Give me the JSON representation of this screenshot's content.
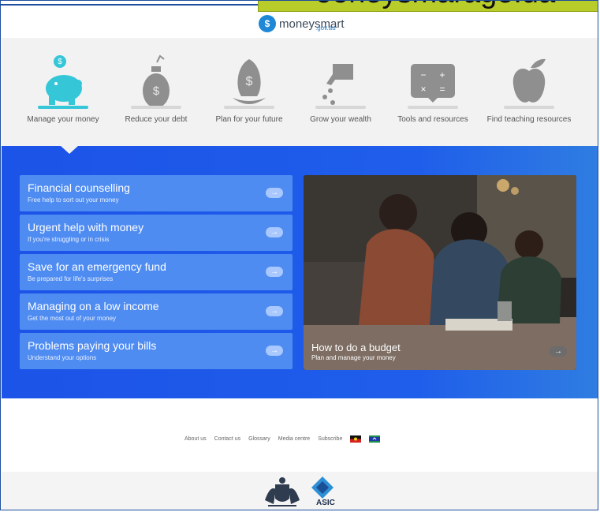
{
  "header": {
    "caption_text": "ooneysmarage.ua",
    "brand_name": "moneysmart",
    "brand_domain": ".gov.au"
  },
  "nav": [
    {
      "label": "Manage your money",
      "icon": "piggy-bank-icon"
    },
    {
      "label": "Reduce your debt",
      "icon": "bomb-icon"
    },
    {
      "label": "Plan for your future",
      "icon": "egg-icon"
    },
    {
      "label": "Grow your wealth",
      "icon": "watering-can-icon"
    },
    {
      "label": "Tools and resources",
      "icon": "calculator-icon"
    },
    {
      "label": "Find teaching resources",
      "icon": "apple-icon"
    }
  ],
  "promos": [
    {
      "title": "Financial counselling",
      "subtitle": "Free help to sort out your money"
    },
    {
      "title": "Urgent help with money",
      "subtitle": "If you're struggling or in crisis"
    },
    {
      "title": "Save for an emergency fund",
      "subtitle": "Be prepared for life's surprises"
    },
    {
      "title": "Managing on a low income",
      "subtitle": "Get the most out of your money"
    },
    {
      "title": "Problems paying your bills",
      "subtitle": "Understand your options"
    }
  ],
  "feature": {
    "title": "How to do a budget",
    "subtitle": "Plan and manage your money"
  },
  "footer": {
    "links": [
      "About us",
      "Contact us",
      "Glossary",
      "Media centre",
      "Subscribe"
    ],
    "asic": "ASIC"
  },
  "colors": {
    "nav_active": "#35c6d8",
    "nav_inactive": "#8f8f8f",
    "band_blue": "#1c53e8",
    "promo_blue": "#4f8cf2"
  }
}
